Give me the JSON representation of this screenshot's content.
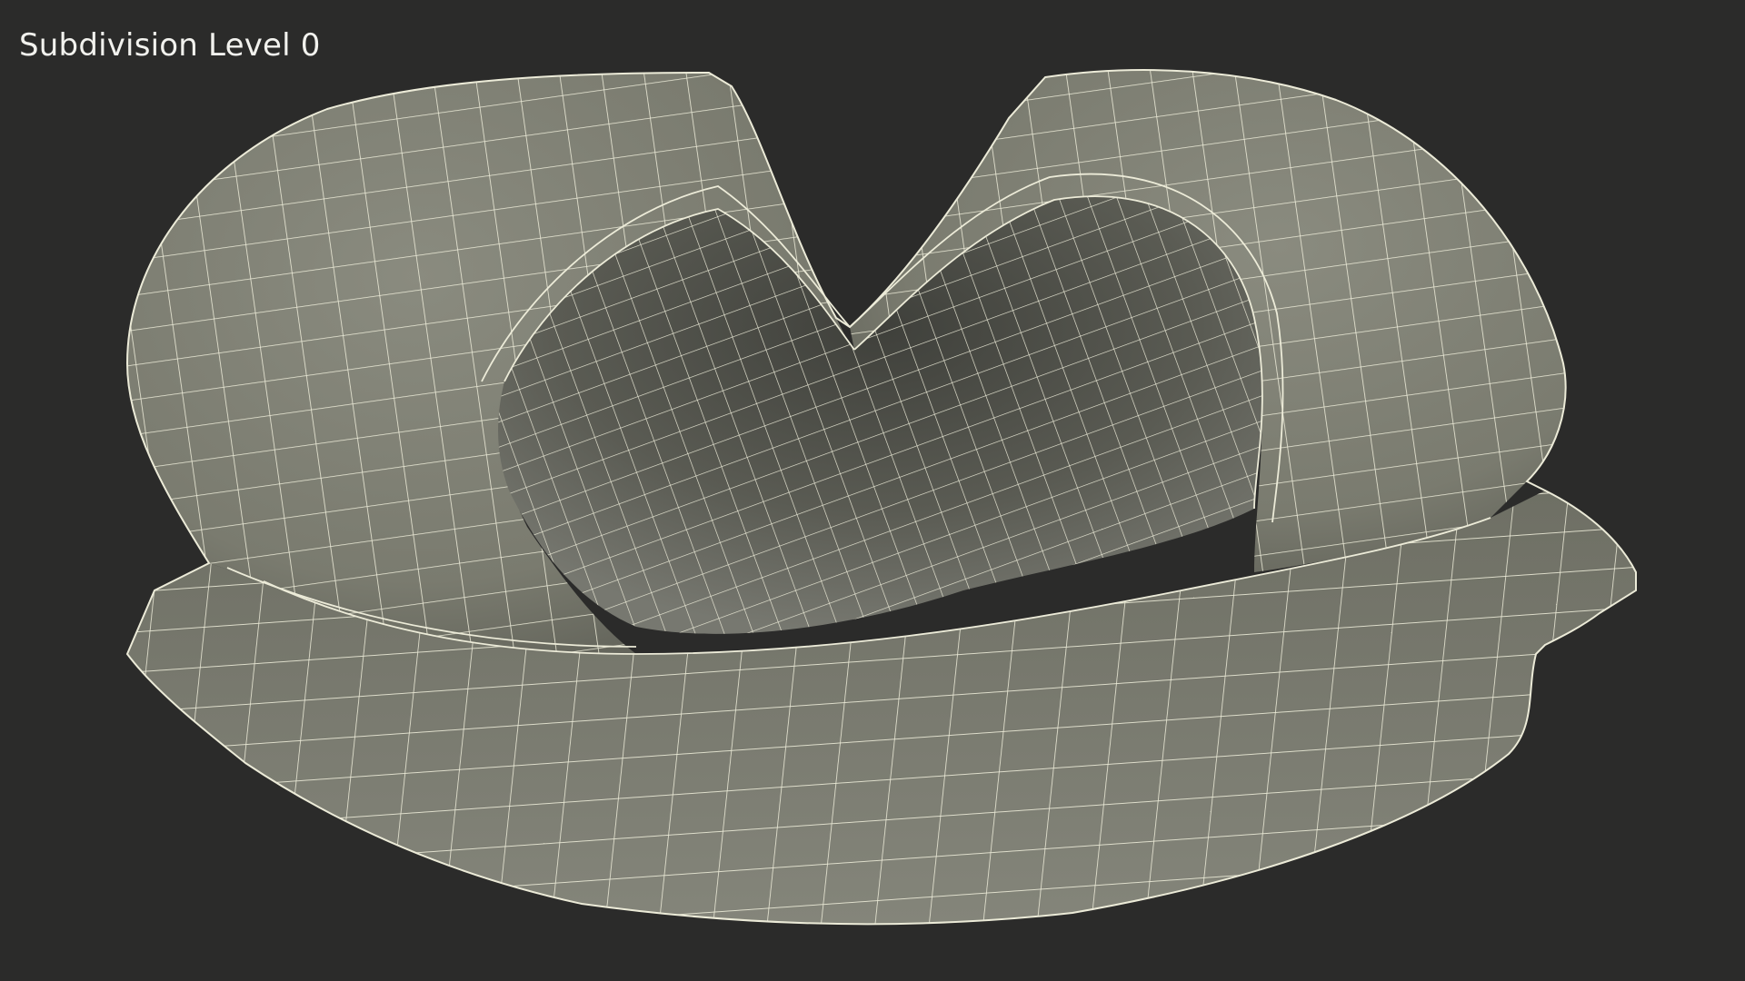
{
  "overlay": {
    "label": "Subdivision Level 0"
  },
  "colors": {
    "background": "#2b2b2a",
    "surface": "#7e7f73",
    "surface_dark": "#4f504a",
    "wire": "#ecebd8",
    "label": "#f2f2ee"
  }
}
